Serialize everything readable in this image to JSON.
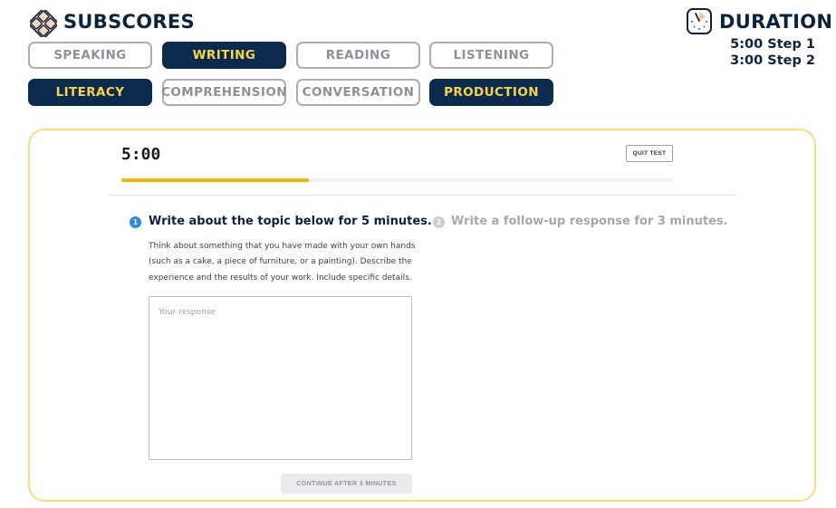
{
  "header": {
    "subscores_title": "SUBSCORES",
    "duration_title": "DURATION",
    "duration_steps": [
      "5:00 Step 1",
      "3:00 Step 2"
    ]
  },
  "subscore_pills": {
    "row1": [
      {
        "label": "SPEAKING",
        "active": false
      },
      {
        "label": "WRITING",
        "active": true
      },
      {
        "label": "READING",
        "active": false
      },
      {
        "label": "LISTENING",
        "active": false
      }
    ],
    "row2": [
      {
        "label": "LITERACY",
        "active": true
      },
      {
        "label": "COMPREHENSION",
        "active": false
      },
      {
        "label": "CONVERSATION",
        "active": false
      },
      {
        "label": "PRODUCTION",
        "active": true
      }
    ]
  },
  "test": {
    "timer": "5:00",
    "quit_label": "QUIT TEST",
    "progress_fraction": 0.34,
    "steps": [
      {
        "number": "1",
        "heading": "Write about the topic below for 5 minutes.",
        "active": true
      },
      {
        "number": "2",
        "heading": "Write a follow-up response for 3 minutes.",
        "active": false
      }
    ],
    "prompt_lines": [
      "Think about something that you have made with your own hands",
      "(such as a cake, a piece of furniture, or a painting). Describe the",
      "experience and the results of your work. Include specific details."
    ],
    "response_placeholder": "Your response",
    "continue_label": "CONTINUE AFTER 3 MINUTES"
  },
  "colors": {
    "navy": "#0c2a4d",
    "accent_yellow": "#f7d54b",
    "progress": "#f5b400",
    "card_border": "#f7de79",
    "active_step": "#2d8ae0",
    "inactive_text": "#8d9198"
  },
  "icons": {
    "subscores": "diamond-grid-icon",
    "duration": "clock-icon"
  }
}
